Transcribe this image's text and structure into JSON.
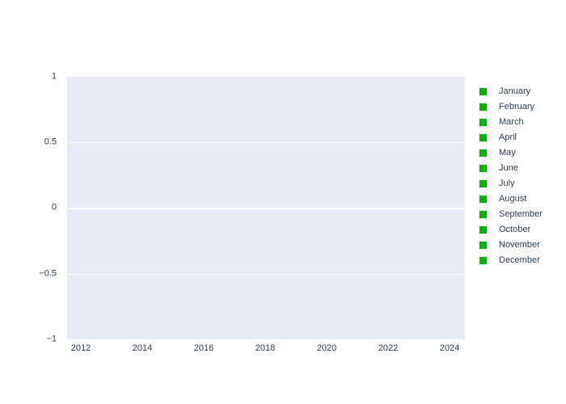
{
  "chart_data": {
    "type": "line",
    "title": "",
    "subtitle": "",
    "xlabel": "",
    "ylabel": "",
    "xlim": [
      2011.2,
      2024.9
    ],
    "ylim": [
      -1,
      1
    ],
    "grid": true,
    "legend_position": "right",
    "x_ticks": [
      "2012",
      "2014",
      "2016",
      "2018",
      "2020",
      "2022",
      "2024"
    ],
    "x_tick_values": [
      2012,
      2014,
      2016,
      2018,
      2020,
      2022,
      2024
    ],
    "y_ticks": [
      "1",
      "0.5",
      "0",
      "−0.5",
      "−1"
    ],
    "y_tick_values": [
      1,
      0.5,
      0,
      -0.5,
      -1
    ],
    "gridline_values": [
      0.5,
      0,
      -0.5
    ],
    "series": [
      {
        "name": "January",
        "color": "#00b400",
        "values": []
      },
      {
        "name": "February",
        "color": "#00b400",
        "values": []
      },
      {
        "name": "March",
        "color": "#00b400",
        "values": []
      },
      {
        "name": "April",
        "color": "#00b400",
        "values": []
      },
      {
        "name": "May",
        "color": "#00b400",
        "values": []
      },
      {
        "name": "June",
        "color": "#00b400",
        "values": []
      },
      {
        "name": "July",
        "color": "#00b400",
        "values": []
      },
      {
        "name": "August",
        "color": "#00b400",
        "values": []
      },
      {
        "name": "September",
        "color": "#00b400",
        "values": []
      },
      {
        "name": "October",
        "color": "#00b400",
        "values": []
      },
      {
        "name": "November",
        "color": "#00b400",
        "values": []
      },
      {
        "name": "December",
        "color": "#00b400",
        "values": []
      }
    ]
  },
  "legend": {
    "items": [
      {
        "label": "January"
      },
      {
        "label": "February"
      },
      {
        "label": "March"
      },
      {
        "label": "April"
      },
      {
        "label": "May"
      },
      {
        "label": "June"
      },
      {
        "label": "July"
      },
      {
        "label": "August"
      },
      {
        "label": "September"
      },
      {
        "label": "October"
      },
      {
        "label": "November"
      },
      {
        "label": "December"
      }
    ]
  },
  "colors": {
    "plot_background": "#e5eaf4",
    "paper_background": "#ffffff",
    "gridline": "#ffffff",
    "tick_text": "#2a3f5f",
    "series_marker": "#00b400"
  }
}
